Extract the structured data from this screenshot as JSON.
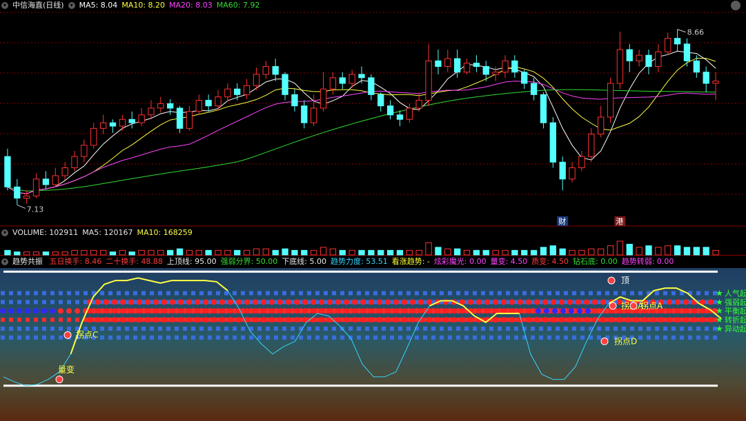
{
  "main_header": {
    "title": "中信海直(日线)",
    "ma5": "MA5: 8.04",
    "ma10": "MA10: 8.20",
    "ma20": "MA20: 8.03",
    "ma60": "MA60: 7.92"
  },
  "volume_header": {
    "title": "VOLUME: 102911",
    "ma5": "MA5: 120167",
    "ma10": "MA10: 168259"
  },
  "indicator_header": {
    "title": "趋势共振",
    "items": [
      {
        "label": "五日换手: 8.46",
        "color": "#ff3b3b"
      },
      {
        "label": "二十换手: 48.88",
        "color": "#ff3b3b"
      },
      {
        "label": "上顶线: 95.00",
        "color": "#e8e8e8"
      },
      {
        "label": "强弱分界: 50.00",
        "color": "#33dd33"
      },
      {
        "label": "下底线: 5.00",
        "color": "#e8e8e8"
      },
      {
        "label": "趋势力度: 53.51",
        "color": "#33d6ff"
      },
      {
        "label": "看涨趋势: -",
        "color": "#ffff33"
      },
      {
        "label": "炫彩魔光: 0.00",
        "color": "#ff44ff"
      },
      {
        "label": "量变: 4.50",
        "color": "#ff44ff"
      },
      {
        "label": "质变: 4.50",
        "color": "#ff3b3b"
      },
      {
        "label": "钻石底: 0.00",
        "color": "#33dd33"
      },
      {
        "label": "趋势转弱: 0.00",
        "color": "#ff44ff"
      }
    ]
  },
  "colors": {
    "up": "#ff3232",
    "down": "#54ffff",
    "ma5": "#ffffff",
    "ma10": "#ffff44",
    "ma20": "#ff44ff",
    "ma60": "#33dd33",
    "grid": "#8a0000"
  },
  "chart_data": [
    {
      "type": "candlestick",
      "price_range": [
        7.0,
        8.8
      ],
      "annotations": {
        "high_label": "8.66",
        "low_label": "7.13",
        "markers": [
          "财",
          "港"
        ]
      },
      "candles": [
        [
          7.55,
          7.28,
          7.62,
          7.25
        ],
        [
          7.28,
          7.18,
          7.35,
          7.12
        ],
        [
          7.18,
          7.2,
          7.25,
          7.13
        ],
        [
          7.2,
          7.35,
          7.4,
          7.18
        ],
        [
          7.35,
          7.3,
          7.42,
          7.26
        ],
        [
          7.3,
          7.38,
          7.45,
          7.28
        ],
        [
          7.38,
          7.45,
          7.5,
          7.34
        ],
        [
          7.45,
          7.55,
          7.6,
          7.42
        ],
        [
          7.55,
          7.65,
          7.7,
          7.5
        ],
        [
          7.65,
          7.8,
          7.85,
          7.62
        ],
        [
          7.8,
          7.85,
          7.92,
          7.75
        ],
        [
          7.85,
          7.82,
          7.88,
          7.76
        ],
        [
          7.82,
          7.88,
          7.92,
          7.78
        ],
        [
          7.88,
          7.85,
          7.95,
          7.8
        ],
        [
          7.85,
          7.92,
          7.98,
          7.82
        ],
        [
          7.92,
          7.98,
          8.05,
          7.88
        ],
        [
          7.98,
          8.02,
          8.08,
          7.94
        ],
        [
          8.02,
          7.98,
          8.06,
          7.92
        ],
        [
          7.98,
          7.8,
          8.0,
          7.76
        ],
        [
          7.8,
          7.95,
          8.0,
          7.78
        ],
        [
          7.95,
          8.05,
          8.1,
          7.92
        ],
        [
          8.05,
          8.0,
          8.1,
          7.95
        ],
        [
          8.0,
          8.08,
          8.14,
          7.96
        ],
        [
          8.08,
          8.15,
          8.2,
          8.04
        ],
        [
          8.15,
          8.1,
          8.2,
          8.05
        ],
        [
          8.1,
          8.18,
          8.24,
          8.06
        ],
        [
          8.18,
          8.28,
          8.34,
          8.14
        ],
        [
          8.28,
          8.35,
          8.4,
          8.24
        ],
        [
          8.35,
          8.28,
          8.42,
          8.22
        ],
        [
          8.28,
          8.1,
          8.3,
          8.05
        ],
        [
          8.1,
          8.0,
          8.15,
          7.95
        ],
        [
          8.0,
          7.85,
          8.05,
          7.8
        ],
        [
          7.85,
          7.98,
          8.1,
          7.82
        ],
        [
          7.98,
          8.15,
          8.3,
          7.95
        ],
        [
          8.15,
          8.25,
          8.3,
          8.1
        ],
        [
          8.25,
          8.2,
          8.3,
          8.15
        ],
        [
          8.2,
          8.28,
          8.32,
          8.16
        ],
        [
          8.28,
          8.25,
          8.35,
          8.2
        ],
        [
          8.25,
          8.1,
          8.28,
          8.05
        ],
        [
          8.1,
          8.0,
          8.12,
          7.95
        ],
        [
          8.0,
          7.92,
          8.05,
          7.88
        ],
        [
          7.92,
          7.88,
          7.96,
          7.82
        ],
        [
          7.88,
          7.98,
          8.02,
          7.85
        ],
        [
          7.98,
          8.05,
          8.12,
          7.95
        ],
        [
          8.05,
          8.4,
          8.55,
          8.0
        ],
        [
          8.4,
          8.35,
          8.5,
          8.28
        ],
        [
          8.35,
          8.42,
          8.5,
          8.3
        ],
        [
          8.42,
          8.3,
          8.5,
          8.25
        ],
        [
          8.3,
          8.38,
          8.42,
          8.28
        ],
        [
          8.38,
          8.35,
          8.45,
          8.3
        ],
        [
          8.35,
          8.28,
          8.4,
          8.22
        ],
        [
          8.28,
          8.3,
          8.35,
          8.22
        ],
        [
          8.3,
          8.4,
          8.45,
          8.25
        ],
        [
          8.4,
          8.3,
          8.45,
          8.25
        ],
        [
          8.3,
          8.2,
          8.32,
          8.15
        ],
        [
          8.2,
          8.1,
          8.25,
          8.05
        ],
        [
          8.1,
          7.85,
          8.12,
          7.8
        ],
        [
          7.85,
          7.5,
          7.9,
          7.45
        ],
        [
          7.5,
          7.35,
          7.55,
          7.25
        ],
        [
          7.35,
          7.45,
          7.5,
          7.32
        ],
        [
          7.45,
          7.55,
          7.6,
          7.42
        ],
        [
          7.55,
          7.75,
          7.8,
          7.5
        ],
        [
          7.75,
          7.9,
          8.0,
          7.72
        ],
        [
          7.9,
          8.2,
          8.25,
          7.85
        ],
        [
          8.2,
          8.5,
          8.66,
          8.15
        ],
        [
          8.5,
          8.4,
          8.55,
          8.3
        ],
        [
          8.4,
          8.45,
          8.5,
          8.35
        ],
        [
          8.45,
          8.35,
          8.5,
          8.28
        ],
        [
          8.35,
          8.48,
          8.55,
          8.3
        ],
        [
          8.48,
          8.6,
          8.65,
          8.45
        ],
        [
          8.6,
          8.55,
          8.68,
          8.48
        ],
        [
          8.55,
          8.4,
          8.6,
          8.35
        ],
        [
          8.4,
          8.3,
          8.45,
          8.25
        ],
        [
          8.3,
          8.2,
          8.35,
          8.12
        ],
        [
          8.2,
          8.22,
          8.3,
          8.05
        ]
      ]
    },
    {
      "type": "bar",
      "series": [
        {
          "name": "VOLUME",
          "values": [
            3,
            2,
            2,
            2,
            2,
            2,
            2,
            3,
            3,
            3,
            3,
            2,
            3,
            2,
            3,
            3,
            3,
            3,
            4,
            3,
            3,
            3,
            3,
            3,
            3,
            3,
            4,
            4,
            3,
            4,
            3,
            3,
            3,
            5,
            4,
            3,
            3,
            3,
            3,
            3,
            3,
            3,
            3,
            3,
            8,
            5,
            4,
            4,
            3,
            3,
            3,
            3,
            3,
            3,
            3,
            3,
            5,
            6,
            4,
            3,
            3,
            4,
            4,
            6,
            9,
            7,
            5,
            6,
            5,
            6,
            6,
            5,
            5,
            5,
            3
          ]
        }
      ]
    },
    {
      "type": "line",
      "ylim": [
        0,
        100
      ],
      "labels": {
        "right": [
          "人气起",
          "强弱起",
          "平衡起",
          "转折起",
          "异动起"
        ],
        "annotations": [
          "拐点C",
          "量变",
          "拐点A",
          "拐点A",
          "拐点D",
          "顶"
        ]
      },
      "series": [
        {
          "name": "趋势力度",
          "color": "#33d6ff",
          "values": [
            12,
            8,
            5,
            6,
            10,
            16,
            30,
            55,
            75,
            85,
            88,
            88,
            90,
            88,
            86,
            88,
            88,
            88,
            88,
            87,
            80,
            66,
            48,
            38,
            30,
            36,
            40,
            55,
            62,
            60,
            52,
            42,
            22,
            12,
            12,
            16,
            35,
            55,
            68,
            72,
            72,
            68,
            60,
            55,
            62,
            62,
            62,
            30,
            14,
            10,
            10,
            20,
            40,
            58,
            70,
            75,
            72,
            72,
            80,
            82,
            82,
            78,
            70,
            65,
            58
          ]
        },
        {
          "name": "看涨趋势",
          "color": "#ffff44",
          "values": [
            null,
            null,
            null,
            null,
            null,
            null,
            30,
            55,
            75,
            85,
            88,
            88,
            90,
            88,
            86,
            88,
            88,
            88,
            88,
            87,
            80,
            null,
            null,
            null,
            null,
            null,
            null,
            null,
            null,
            null,
            null,
            null,
            null,
            null,
            null,
            null,
            null,
            null,
            68,
            72,
            72,
            68,
            60,
            55,
            62,
            62,
            62,
            null,
            null,
            null,
            null,
            null,
            null,
            null,
            70,
            75,
            72,
            72,
            80,
            82,
            82,
            78,
            70,
            65,
            58
          ]
        }
      ]
    }
  ]
}
